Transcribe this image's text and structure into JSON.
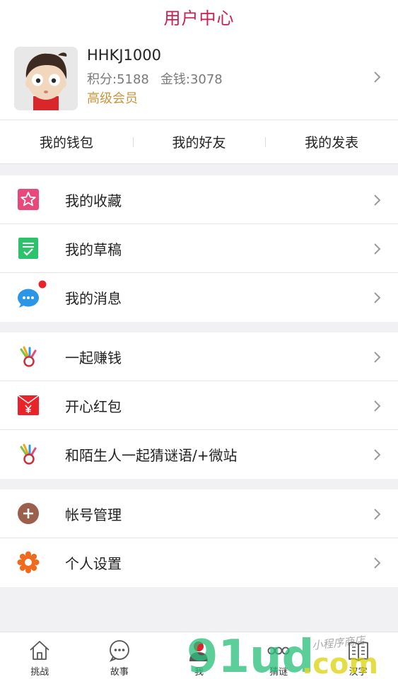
{
  "header": {
    "title": "用户中心"
  },
  "profile": {
    "username": "HHKJ1000",
    "points": "积分:5188",
    "money": "金钱:3078",
    "level": "高级会员"
  },
  "quicklinks": [
    "我的钱包",
    "我的好友",
    "我的发表"
  ],
  "menu_groups": [
    [
      {
        "label": "我的收藏",
        "icon": "star-icon",
        "color": "#e8487a"
      },
      {
        "label": "我的草稿",
        "icon": "draft-icon",
        "color": "#2cc36b"
      },
      {
        "label": "我的消息",
        "icon": "message-icon",
        "color": "#2b95e8"
      }
    ],
    [
      {
        "label": "一起赚钱",
        "icon": "badge-icon"
      },
      {
        "label": "开心红包",
        "icon": "red-envelope-icon",
        "color": "#e8232a"
      },
      {
        "label": "和陌生人一起猜谜语/+微站",
        "icon": "badge-icon"
      }
    ],
    [
      {
        "label": "帐号管理",
        "icon": "plus-circle-icon",
        "color": "#9b604b"
      },
      {
        "label": "个人设置",
        "icon": "gear-icon",
        "color": "#f06a1e"
      }
    ]
  ],
  "tabbar": [
    {
      "label": "挑战",
      "icon": "home-icon"
    },
    {
      "label": "故事",
      "icon": "chat-icon"
    },
    {
      "label": "我",
      "icon": "user-icon",
      "active": true
    },
    {
      "label": "猜谜",
      "icon": "riddle-icon"
    },
    {
      "label": "汉字",
      "icon": "book-icon"
    }
  ],
  "watermark": {
    "logo": "91ud.com",
    "tagline": "小程序商店"
  }
}
